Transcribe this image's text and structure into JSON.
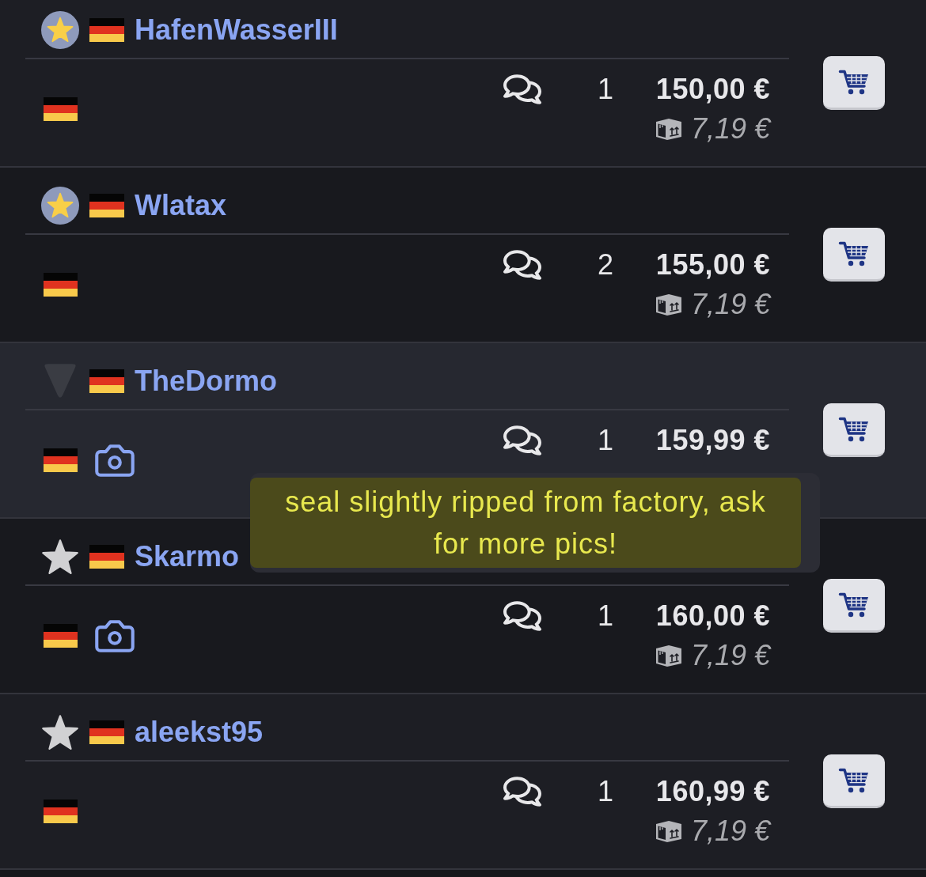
{
  "rows": [
    {
      "seller": {
        "name": "HafenWasserIII",
        "badge": {
          "kind": "disc"
        }
      },
      "selected": false,
      "has_photo": false,
      "quantity": "1",
      "price": "150,00 €",
      "shipping": "7,19 €"
    },
    {
      "seller": {
        "name": "Wlatax",
        "badge": {
          "kind": "disc"
        }
      },
      "selected": false,
      "has_photo": false,
      "quantity": "2",
      "price": "155,00 €",
      "shipping": "7,19 €"
    },
    {
      "seller": {
        "name": "TheDormo",
        "badge": {
          "kind": "triangle"
        }
      },
      "selected": true,
      "has_photo": true,
      "quantity": "1",
      "price": "159,99 €",
      "comment_tooltip": "seal slightly ripped from factory, ask for more pics!"
    },
    {
      "seller": {
        "name": "Skarmo",
        "badge": {
          "kind": "star"
        }
      },
      "selected": false,
      "has_photo": true,
      "quantity": "1",
      "price": "160,00 €",
      "shipping": "7,19 €"
    },
    {
      "seller": {
        "name": "aleekst95",
        "badge": {
          "kind": "star"
        }
      },
      "selected": false,
      "has_photo": false,
      "quantity": "1",
      "price": "160,99 €",
      "shipping": "7,19 €"
    }
  ]
}
